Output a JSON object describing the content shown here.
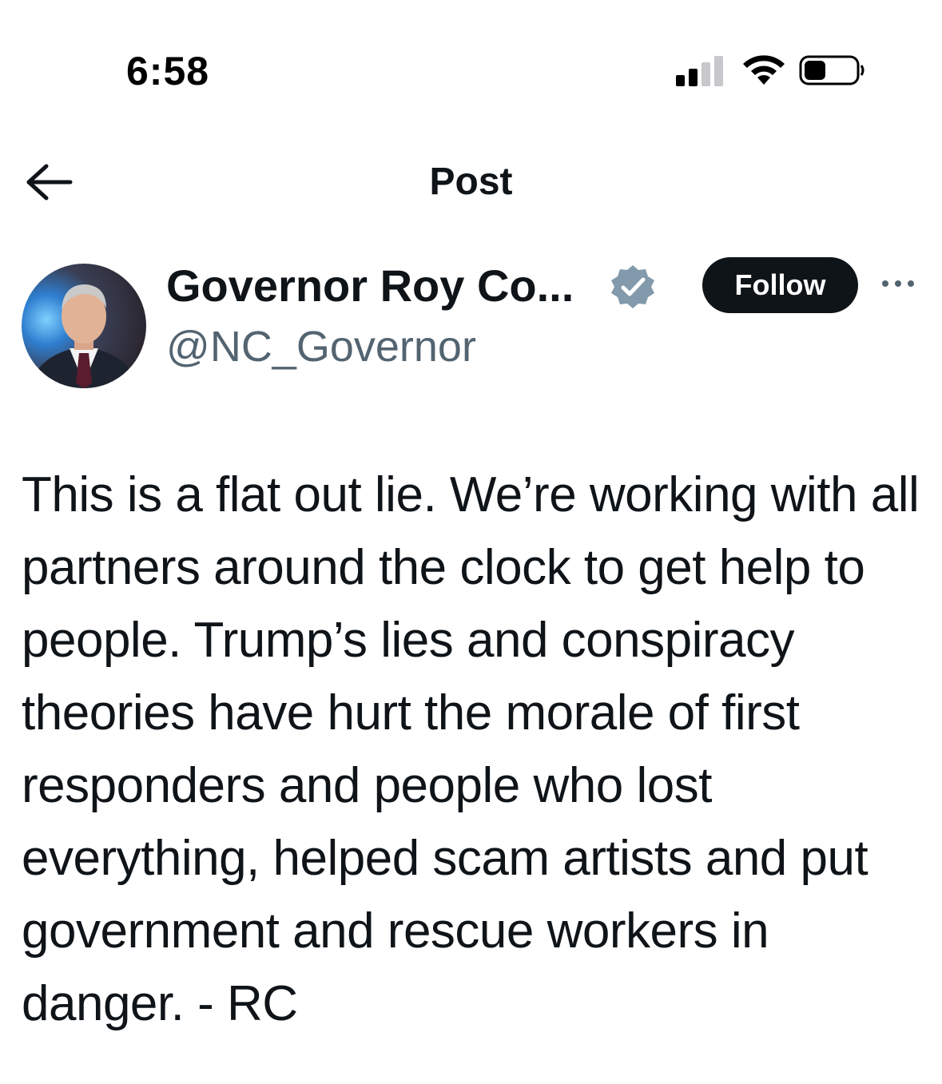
{
  "status_bar": {
    "time": "6:58",
    "icons": [
      "cellular-signal-icon",
      "wifi-icon",
      "battery-icon"
    ]
  },
  "header": {
    "back_icon": "back-arrow-icon",
    "title": "Post"
  },
  "author": {
    "name": "Governor Roy Co...",
    "handle": "@NC_Governor",
    "verified_icon": "verified-badge-icon",
    "follow_label": "Follow",
    "more_icon": "more-options-icon"
  },
  "post": {
    "text": "This is a flat out lie. We’re working with all partners around the clock to get help to people. Trump’s lies and conspiracy theories have hurt the morale of first responders and people who lost everything, helped scam artists and put government and rescue workers in danger. - RC"
  },
  "colors": {
    "text": "#0f1419",
    "secondary_text": "#536471",
    "follow_bg": "#0f1419",
    "follow_text": "#ffffff",
    "verified_badge": "#829aab"
  }
}
